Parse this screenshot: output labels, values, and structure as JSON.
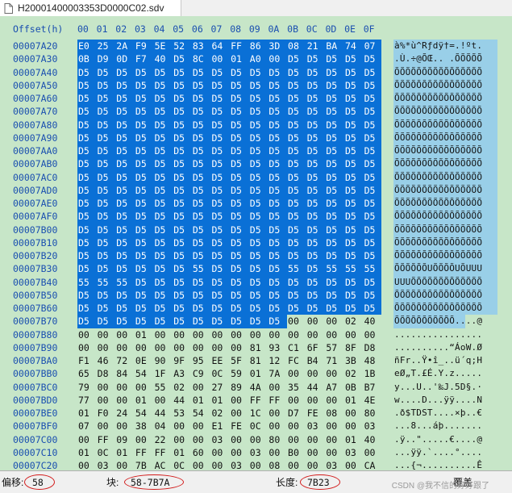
{
  "tab": {
    "filename": "H20001400003353D0000C02.sdv"
  },
  "header": {
    "offset_label": "Offset(h)",
    "columns": [
      "00",
      "01",
      "02",
      "03",
      "04",
      "05",
      "06",
      "07",
      "08",
      "09",
      "0A",
      "0B",
      "0C",
      "0D",
      "0E",
      "0F"
    ]
  },
  "rows": [
    {
      "offset": "00007A20",
      "bytes": [
        "E0",
        "25",
        "2A",
        "F9",
        "5E",
        "52",
        "83",
        "64",
        "FF",
        "86",
        "3D",
        "08",
        "21",
        "BA",
        "74",
        "07"
      ],
      "ascii": "à%*ù^Rƒdÿ†=.!ºt."
    },
    {
      "offset": "00007A30",
      "bytes": [
        "0B",
        "D9",
        "0D",
        "F7",
        "40",
        "D5",
        "8C",
        "00",
        "01",
        "A0",
        "00",
        "D5",
        "D5",
        "D5",
        "D5",
        "D5"
      ],
      "ascii": ".Ù.÷@ÕŒ.. .ÕÕÕÕÕ"
    },
    {
      "offset": "00007A40",
      "bytes": [
        "D5",
        "D5",
        "D5",
        "D5",
        "D5",
        "D5",
        "D5",
        "D5",
        "D5",
        "D5",
        "D5",
        "D5",
        "D5",
        "D5",
        "D5",
        "D5"
      ],
      "ascii": "ÕÕÕÕÕÕÕÕÕÕÕÕÕÕÕÕ"
    },
    {
      "offset": "00007A50",
      "bytes": [
        "D5",
        "D5",
        "D5",
        "D5",
        "D5",
        "D5",
        "D5",
        "D5",
        "D5",
        "D5",
        "D5",
        "D5",
        "D5",
        "D5",
        "D5",
        "D5"
      ],
      "ascii": "ÕÕÕÕÕÕÕÕÕÕÕÕÕÕÕÕ"
    },
    {
      "offset": "00007A60",
      "bytes": [
        "D5",
        "D5",
        "D5",
        "D5",
        "D5",
        "D5",
        "D5",
        "D5",
        "D5",
        "D5",
        "D5",
        "D5",
        "D5",
        "D5",
        "D5",
        "D5"
      ],
      "ascii": "ÕÕÕÕÕÕÕÕÕÕÕÕÕÕÕÕ"
    },
    {
      "offset": "00007A70",
      "bytes": [
        "D5",
        "D5",
        "D5",
        "D5",
        "D5",
        "D5",
        "D5",
        "D5",
        "D5",
        "D5",
        "D5",
        "D5",
        "D5",
        "D5",
        "D5",
        "D5"
      ],
      "ascii": "ÕÕÕÕÕÕÕÕÕÕÕÕÕÕÕÕ"
    },
    {
      "offset": "00007A80",
      "bytes": [
        "D5",
        "D5",
        "D5",
        "D5",
        "D5",
        "D5",
        "D5",
        "D5",
        "D5",
        "D5",
        "D5",
        "D5",
        "D5",
        "D5",
        "D5",
        "D5"
      ],
      "ascii": "ÕÕÕÕÕÕÕÕÕÕÕÕÕÕÕÕ"
    },
    {
      "offset": "00007A90",
      "bytes": [
        "D5",
        "D5",
        "D5",
        "D5",
        "D5",
        "D5",
        "D5",
        "D5",
        "D5",
        "D5",
        "D5",
        "D5",
        "D5",
        "D5",
        "D5",
        "D5"
      ],
      "ascii": "ÕÕÕÕÕÕÕÕÕÕÕÕÕÕÕÕ"
    },
    {
      "offset": "00007AA0",
      "bytes": [
        "D5",
        "D5",
        "D5",
        "D5",
        "D5",
        "D5",
        "D5",
        "D5",
        "D5",
        "D5",
        "D5",
        "D5",
        "D5",
        "D5",
        "D5",
        "D5"
      ],
      "ascii": "ÕÕÕÕÕÕÕÕÕÕÕÕÕÕÕÕ"
    },
    {
      "offset": "00007AB0",
      "bytes": [
        "D5",
        "D5",
        "D5",
        "D5",
        "D5",
        "D5",
        "D5",
        "D5",
        "D5",
        "D5",
        "D5",
        "D5",
        "D5",
        "D5",
        "D5",
        "D5"
      ],
      "ascii": "ÕÕÕÕÕÕÕÕÕÕÕÕÕÕÕÕ"
    },
    {
      "offset": "00007AC0",
      "bytes": [
        "D5",
        "D5",
        "D5",
        "D5",
        "D5",
        "D5",
        "D5",
        "D5",
        "D5",
        "D5",
        "D5",
        "D5",
        "D5",
        "D5",
        "D5",
        "D5"
      ],
      "ascii": "ÕÕÕÕÕÕÕÕÕÕÕÕÕÕÕÕ"
    },
    {
      "offset": "00007AD0",
      "bytes": [
        "D5",
        "D5",
        "D5",
        "D5",
        "D5",
        "D5",
        "D5",
        "D5",
        "D5",
        "D5",
        "D5",
        "D5",
        "D5",
        "D5",
        "D5",
        "D5"
      ],
      "ascii": "ÕÕÕÕÕÕÕÕÕÕÕÕÕÕÕÕ"
    },
    {
      "offset": "00007AE0",
      "bytes": [
        "D5",
        "D5",
        "D5",
        "D5",
        "D5",
        "D5",
        "D5",
        "D5",
        "D5",
        "D5",
        "D5",
        "D5",
        "D5",
        "D5",
        "D5",
        "D5"
      ],
      "ascii": "ÕÕÕÕÕÕÕÕÕÕÕÕÕÕÕÕ"
    },
    {
      "offset": "00007AF0",
      "bytes": [
        "D5",
        "D5",
        "D5",
        "D5",
        "D5",
        "D5",
        "D5",
        "D5",
        "D5",
        "D5",
        "D5",
        "D5",
        "D5",
        "D5",
        "D5",
        "D5"
      ],
      "ascii": "ÕÕÕÕÕÕÕÕÕÕÕÕÕÕÕÕ"
    },
    {
      "offset": "00007B00",
      "bytes": [
        "D5",
        "D5",
        "D5",
        "D5",
        "D5",
        "D5",
        "D5",
        "D5",
        "D5",
        "D5",
        "D5",
        "D5",
        "D5",
        "D5",
        "D5",
        "D5"
      ],
      "ascii": "ÕÕÕÕÕÕÕÕÕÕÕÕÕÕÕÕ"
    },
    {
      "offset": "00007B10",
      "bytes": [
        "D5",
        "D5",
        "D5",
        "D5",
        "D5",
        "D5",
        "D5",
        "D5",
        "D5",
        "D5",
        "D5",
        "D5",
        "D5",
        "D5",
        "D5",
        "D5"
      ],
      "ascii": "ÕÕÕÕÕÕÕÕÕÕÕÕÕÕÕÕ"
    },
    {
      "offset": "00007B20",
      "bytes": [
        "D5",
        "D5",
        "D5",
        "D5",
        "D5",
        "D5",
        "D5",
        "D5",
        "D5",
        "D5",
        "D5",
        "D5",
        "D5",
        "D5",
        "D5",
        "D5"
      ],
      "ascii": "ÕÕÕÕÕÕÕÕÕÕÕÕÕÕÕÕ"
    },
    {
      "offset": "00007B30",
      "bytes": [
        "D5",
        "D5",
        "D5",
        "D5",
        "D5",
        "D5",
        "55",
        "D5",
        "D5",
        "D5",
        "D5",
        "55",
        "D5",
        "55",
        "55",
        "55"
      ],
      "ascii": "ÕÕÕÕÕÕUÕÕÕÕUÕUUU"
    },
    {
      "offset": "00007B40",
      "bytes": [
        "55",
        "55",
        "55",
        "D5",
        "D5",
        "D5",
        "D5",
        "D5",
        "D5",
        "D5",
        "D5",
        "D5",
        "D5",
        "D5",
        "D5",
        "D5"
      ],
      "ascii": "UUUÕÕÕÕÕÕÕÕÕÕÕÕÕ"
    },
    {
      "offset": "00007B50",
      "bytes": [
        "D5",
        "D5",
        "D5",
        "D5",
        "D5",
        "D5",
        "D5",
        "D5",
        "D5",
        "D5",
        "D5",
        "D5",
        "D5",
        "D5",
        "D5",
        "D5"
      ],
      "ascii": "ÕÕÕÕÕÕÕÕÕÕÕÕÕÕÕÕ"
    },
    {
      "offset": "00007B60",
      "bytes": [
        "D5",
        "D5",
        "D5",
        "D5",
        "D5",
        "D5",
        "D5",
        "D5",
        "D5",
        "D5",
        "D5",
        "D5",
        "D5",
        "D5",
        "D5",
        "D5"
      ],
      "ascii": "ÕÕÕÕÕÕÕÕÕÕÕÕÕÕÕÕ"
    },
    {
      "offset": "00007B70",
      "bytes": [
        "D5",
        "D5",
        "D5",
        "D5",
        "D5",
        "D5",
        "D5",
        "D5",
        "D5",
        "D5",
        "D5",
        "00",
        "00",
        "00",
        "02",
        "40"
      ],
      "ascii": "ÕÕÕÕÕÕÕÕÕÕÕ....@"
    },
    {
      "offset": "00007B80",
      "bytes": [
        "00",
        "00",
        "00",
        "01",
        "00",
        "00",
        "00",
        "00",
        "00",
        "00",
        "00",
        "00",
        "00",
        "00",
        "00",
        "00"
      ],
      "ascii": "................"
    },
    {
      "offset": "00007B90",
      "bytes": [
        "00",
        "00",
        "00",
        "00",
        "00",
        "00",
        "00",
        "00",
        "00",
        "81",
        "93",
        "C1",
        "6F",
        "57",
        "8F",
        "D8"
      ],
      "ascii": "..........“ÁoW.Ø"
    },
    {
      "offset": "00007BA0",
      "bytes": [
        "F1",
        "46",
        "72",
        "0E",
        "90",
        "9F",
        "95",
        "EE",
        "5F",
        "81",
        "12",
        "FC",
        "B4",
        "71",
        "3B",
        "48"
      ],
      "ascii": "ñFr..Ÿ•î_..ü´q;H"
    },
    {
      "offset": "00007BB0",
      "bytes": [
        "65",
        "D8",
        "84",
        "54",
        "1F",
        "A3",
        "C9",
        "0C",
        "59",
        "01",
        "7A",
        "00",
        "00",
        "00",
        "02",
        "1B"
      ],
      "ascii": "eØ„T.£É.Y.z....."
    },
    {
      "offset": "00007BC0",
      "bytes": [
        "79",
        "00",
        "00",
        "00",
        "55",
        "02",
        "00",
        "27",
        "89",
        "4A",
        "00",
        "35",
        "44",
        "A7",
        "0B",
        "B7"
      ],
      "ascii": "y...U..'‰J.5D§.·"
    },
    {
      "offset": "00007BD0",
      "bytes": [
        "77",
        "00",
        "00",
        "01",
        "00",
        "44",
        "01",
        "01",
        "00",
        "FF",
        "FF",
        "00",
        "00",
        "00",
        "01",
        "4E"
      ],
      "ascii": "w....D...ÿÿ....N"
    },
    {
      "offset": "00007BE0",
      "bytes": [
        "01",
        "F0",
        "24",
        "54",
        "44",
        "53",
        "54",
        "02",
        "00",
        "1C",
        "00",
        "D7",
        "FE",
        "08",
        "00",
        "80"
      ],
      "ascii": ".ð$TDST....×þ..€"
    },
    {
      "offset": "00007BF0",
      "bytes": [
        "07",
        "00",
        "00",
        "38",
        "04",
        "00",
        "00",
        "E1",
        "FE",
        "0C",
        "00",
        "00",
        "03",
        "00",
        "00",
        "03"
      ],
      "ascii": "...8...áþ......."
    },
    {
      "offset": "00007C00",
      "bytes": [
        "00",
        "FF",
        "09",
        "00",
        "22",
        "00",
        "00",
        "03",
        "00",
        "00",
        "80",
        "00",
        "00",
        "00",
        "01",
        "40"
      ],
      "ascii": ".ÿ..\".....€....@"
    },
    {
      "offset": "00007C10",
      "bytes": [
        "01",
        "0C",
        "01",
        "FF",
        "FF",
        "01",
        "60",
        "00",
        "00",
        "03",
        "00",
        "B0",
        "00",
        "00",
        "03",
        "00"
      ],
      "ascii": "...ÿÿ.`....°...."
    },
    {
      "offset": "00007C20",
      "bytes": [
        "00",
        "03",
        "00",
        "7B",
        "AC",
        "0C",
        "00",
        "00",
        "03",
        "00",
        "08",
        "00",
        "00",
        "03",
        "00",
        "CA"
      ],
      "ascii": "...{¬..........Ê"
    }
  ],
  "status": {
    "offset_label": "偏移:",
    "offset_value": "58",
    "block_label": "块:",
    "block_value": "58-7B7A",
    "length_label": "长度:",
    "length_value": "7B23",
    "overflow_label": "覆盖",
    "watermark": "CSDN @我不信的好好跟了"
  },
  "colors": {
    "hex_background": "#c7e6c8",
    "selection": "#0a70d6",
    "ascii_selection": "#99cfe8",
    "offset_text": "#1a4fb0",
    "annotation_circle": "#d21a1a"
  }
}
